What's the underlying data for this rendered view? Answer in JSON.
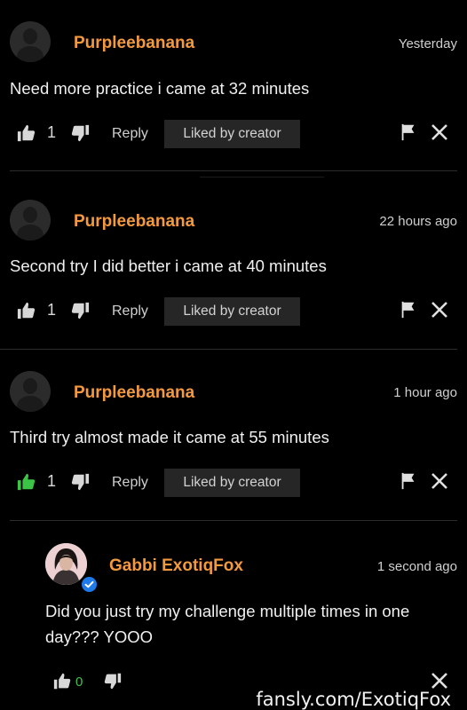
{
  "comments": [
    {
      "username": "Purpleebanana",
      "time": "Yesterday",
      "text": "Need more practice i came at 32 minutes",
      "likes": "1",
      "reply_label": "Reply",
      "badge": "Liked by creator",
      "liked": false
    },
    {
      "username": "Purpleebanana",
      "time": "22 hours ago",
      "text": "Second try I did better i came at 40 minutes",
      "likes": "1",
      "reply_label": "Reply",
      "badge": "Liked by creator",
      "liked": false
    },
    {
      "username": "Purpleebanana",
      "time": "1 hour ago",
      "text": "Third try almost made it came at 55 minutes",
      "likes": "1",
      "reply_label": "Reply",
      "badge": "Liked by creator",
      "liked": true
    }
  ],
  "reply": {
    "username": "Gabbi ExotiqFox",
    "time": "1 second ago",
    "text_line1": "Did you just try my challenge multiple times in one",
    "text_line2": "day??? YOOO",
    "likes": "0"
  },
  "watermark": "fansly.com/ExotiqFox",
  "colors": {
    "username": "#f39a3e",
    "liked_green": "#3cc447",
    "likes_zero_green": "#3cc447",
    "verified_blue": "#1e7ae8",
    "badge_bg": "#262626"
  }
}
